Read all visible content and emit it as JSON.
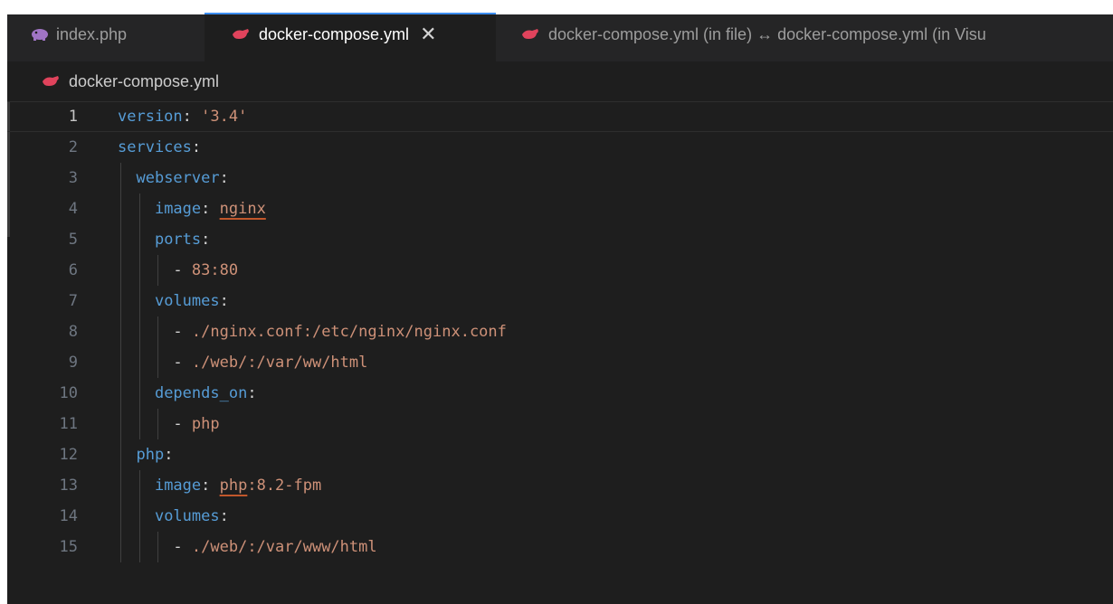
{
  "tabs": [
    {
      "label": "index.php",
      "icon": "php-elephant-icon",
      "icon_color": "#a074c4",
      "active": false
    },
    {
      "label": "docker-compose.yml",
      "icon": "docker-whale-icon",
      "icon_color": "#e0435c",
      "active": true,
      "close": "✕"
    },
    {
      "label": "docker-compose.yml (in file) ↔ docker-compose.yml (in Visu",
      "icon": "docker-whale-icon",
      "icon_color": "#e0435c",
      "active": false
    }
  ],
  "breadcrumb": {
    "file": "docker-compose.yml",
    "icon": "docker-whale-icon"
  },
  "editor": {
    "current_line": 1,
    "lines": [
      {
        "n": "1",
        "t": [
          [
            "key",
            "version"
          ],
          [
            "plain",
            ": "
          ],
          [
            "str",
            "'3.4'"
          ]
        ]
      },
      {
        "n": "2",
        "t": [
          [
            "key",
            "services"
          ],
          [
            "plain",
            ":"
          ]
        ]
      },
      {
        "n": "3",
        "t": [
          [
            "plain",
            "  "
          ],
          [
            "key",
            "webserver"
          ],
          [
            "plain",
            ":"
          ]
        ]
      },
      {
        "n": "4",
        "t": [
          [
            "plain",
            "    "
          ],
          [
            "key",
            "image"
          ],
          [
            "plain",
            ": "
          ],
          [
            "strul",
            "nginx"
          ]
        ]
      },
      {
        "n": "5",
        "t": [
          [
            "plain",
            "    "
          ],
          [
            "key",
            "ports"
          ],
          [
            "plain",
            ":"
          ]
        ]
      },
      {
        "n": "6",
        "t": [
          [
            "plain",
            "      "
          ],
          [
            "plain",
            "- "
          ],
          [
            "str",
            "83:80"
          ]
        ]
      },
      {
        "n": "7",
        "t": [
          [
            "plain",
            "    "
          ],
          [
            "key",
            "volumes"
          ],
          [
            "plain",
            ":"
          ]
        ]
      },
      {
        "n": "8",
        "t": [
          [
            "plain",
            "      "
          ],
          [
            "plain",
            "- "
          ],
          [
            "str",
            "./nginx.conf:/etc/nginx/nginx.conf"
          ]
        ]
      },
      {
        "n": "9",
        "t": [
          [
            "plain",
            "      "
          ],
          [
            "plain",
            "- "
          ],
          [
            "str",
            "./web/:/var/ww/html"
          ]
        ]
      },
      {
        "n": "10",
        "t": [
          [
            "plain",
            "    "
          ],
          [
            "key",
            "depends_on"
          ],
          [
            "plain",
            ":"
          ]
        ]
      },
      {
        "n": "11",
        "t": [
          [
            "plain",
            "      "
          ],
          [
            "plain",
            "- "
          ],
          [
            "str",
            "php"
          ]
        ]
      },
      {
        "n": "12",
        "t": [
          [
            "plain",
            "  "
          ],
          [
            "key",
            "php"
          ],
          [
            "plain",
            ":"
          ]
        ]
      },
      {
        "n": "13",
        "t": [
          [
            "plain",
            "    "
          ],
          [
            "key",
            "image"
          ],
          [
            "plain",
            ": "
          ],
          [
            "strul",
            "php"
          ],
          [
            "str",
            ":8.2-fpm"
          ]
        ]
      },
      {
        "n": "14",
        "t": [
          [
            "plain",
            "    "
          ],
          [
            "key",
            "volumes"
          ],
          [
            "plain",
            ":"
          ]
        ]
      },
      {
        "n": "15",
        "t": [
          [
            "plain",
            "      "
          ],
          [
            "plain",
            "- "
          ],
          [
            "str",
            "./web/:/var/www/html"
          ]
        ]
      }
    ]
  }
}
